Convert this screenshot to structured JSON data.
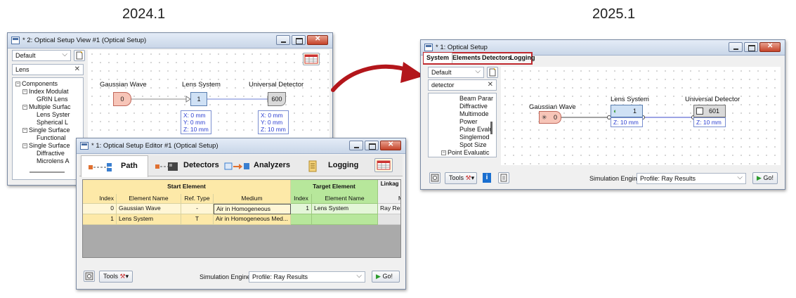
{
  "versions": {
    "left": "2024.1",
    "right": "2025.1"
  },
  "view_window": {
    "title": "* 2: Optical Setup View #1 (Optical Setup)",
    "preset": "Default",
    "search": "Lens",
    "tree": [
      "Components",
      "Index Modulat",
      "GRIN Lens",
      "Multiple Surfac",
      "Lens Syster",
      "Spherical L",
      "Single Surface",
      "Functional",
      "Single Surface",
      "Diffractive",
      "Microlens A"
    ],
    "elements": {
      "source": {
        "name": "Gaussian Wave",
        "index": "0"
      },
      "system": {
        "name": "Lens System",
        "index": "1",
        "coords": [
          "X: 0 mm",
          "Y: 0 mm",
          "Z: 10 mm"
        ]
      },
      "detector": {
        "name": "Universal Detector",
        "index": "600",
        "coords": [
          "X: 0 mm",
          "Y: 0 mm",
          "Z: 10 mm"
        ]
      }
    }
  },
  "editor_window": {
    "title": "* 1: Optical Setup Editor #1 (Optical Setup)",
    "tabs": [
      "Path",
      "Detectors",
      "Analyzers",
      "Logging"
    ],
    "group_headers": {
      "start": "Start Element",
      "target": "Target Element",
      "linkage": "Linkag e"
    },
    "columns": [
      "Index",
      "Element Name",
      "Ref. Type",
      "Medium",
      "Index",
      "Element Name",
      "M"
    ],
    "rows": [
      [
        "0",
        "Gaussian Wave",
        "-",
        "Air in Homogeneous",
        "1",
        "Lens System",
        "Ray Resu"
      ],
      [
        "1",
        "Lens System",
        "T",
        "Air in Homogeneous Med...",
        "",
        "",
        ""
      ]
    ],
    "tools_label": "Tools",
    "engine_label": "Simulation Engine",
    "engine_value": "Profile: Ray Results",
    "go_label": "Go!"
  },
  "new_window": {
    "title": "* 1: Optical Setup",
    "tabs": [
      "System",
      "Elements",
      "Detectors",
      "Logging"
    ],
    "preset": "Default",
    "search": "detector",
    "tree": [
      "Beam Parar",
      "Diffractive",
      "Multimode",
      "Power",
      "Pulse Evalu",
      "Singlemod",
      "Spot Size",
      "Point Evaluatic"
    ],
    "elements": {
      "source": {
        "name": "Gaussian Wave",
        "index": "0"
      },
      "system": {
        "name": "Lens System",
        "index": "1",
        "coords": [
          "Z: 10 mm"
        ]
      },
      "detector": {
        "name": "Universal Detector",
        "index": "601",
        "coords": [
          "Z: 10 mm"
        ]
      }
    },
    "tools_label": "Tools",
    "engine_label": "Simulation Engine",
    "engine_value": "Profile: Ray Results",
    "go_label": "Go!"
  },
  "colors": {
    "source_fill": "#f7c5b8",
    "system_fill": "#cfe1f5",
    "detector_fill": "#d9d9d9",
    "start_header": "#fde9a8",
    "target_header": "#b7e79b",
    "highlight_border": "#c0282d",
    "arrow": "#b3161b"
  }
}
